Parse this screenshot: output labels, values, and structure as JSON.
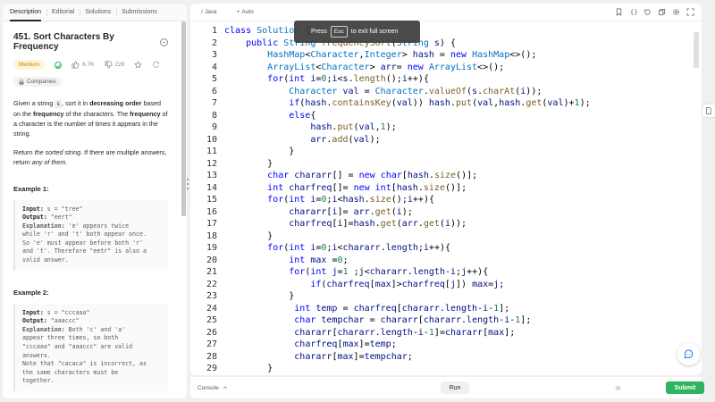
{
  "left_tabs": [
    "Description",
    "Editorial",
    "Solutions",
    "Submissions"
  ],
  "problem": {
    "title": "451. Sort Characters By Frequency",
    "difficulty": "Medium",
    "likes": "6.7K",
    "dislikes": "229",
    "companies_label": "Companies",
    "para1_parts": [
      "Given a string ",
      "s",
      ", sort it in ",
      "decreasing order",
      " based on the ",
      "frequency",
      " of the characters. The ",
      "frequency",
      " of a character is the number of times it appears in the string."
    ],
    "para2_parts": [
      "Return ",
      "the sorted string",
      ". If there are multiple answers, return ",
      "any of them",
      "."
    ]
  },
  "examples": [
    {
      "title": "Example 1:",
      "input_label": "Input:",
      "input": " s = \"tree\"",
      "output_label": "Output:",
      "output": " \"eert\"",
      "explanation_label": "Explanation:",
      "explanation": " 'e' appears twice\nwhile 'r' and 't' both appear once.\nSo 'e' must appear before both 'r'\nand 't'. Therefore \"eetr\" is also a\nvalid answer."
    },
    {
      "title": "Example 2:",
      "input_label": "Input:",
      "input": " s = \"cccaaa\"",
      "output_label": "Output:",
      "output": " \"aaaccc\"",
      "explanation_label": "Explanation:",
      "explanation": " Both 'c' and 'a'\nappear three times, so both\n\"cccaaa\" and \"aaaccc\" are valid\nanswers.\nNote that \"cacaca\" is incorrect, as\nthe same characters must be\ntogether."
    }
  ],
  "editor": {
    "language": "Java",
    "auto_label": "Auto",
    "toast_press": "Press",
    "toast_key": "Esc",
    "toast_rest": "to exit full screen",
    "console_label": "Console",
    "run_label": "Run",
    "submit_label": "Submit"
  },
  "code_lines": [
    {
      "n": "1",
      "t": "class Solution {"
    },
    {
      "n": "2",
      "t": "    public String frequencySort(String s) {"
    },
    {
      "n": "3",
      "t": "        HashMap<Character,Integer> hash = new HashMap<>();"
    },
    {
      "n": "4",
      "t": "        ArrayList<Character> arr= new ArrayList<>();"
    },
    {
      "n": "5",
      "t": "        for(int i=0;i<s.length();i++){"
    },
    {
      "n": "6",
      "t": "            Character val = Character.valueOf(s.charAt(i));"
    },
    {
      "n": "7",
      "t": "            if(hash.containsKey(val)) hash.put(val,hash.get(val)+1);"
    },
    {
      "n": "8",
      "t": "            else{"
    },
    {
      "n": "9",
      "t": "                hash.put(val,1);"
    },
    {
      "n": "10",
      "t": "                arr.add(val);"
    },
    {
      "n": "11",
      "t": "            }"
    },
    {
      "n": "12",
      "t": "        }"
    },
    {
      "n": "13",
      "t": "        char chararr[] = new char[hash.size()];"
    },
    {
      "n": "14",
      "t": "        int charfreq[]= new int[hash.size()];"
    },
    {
      "n": "15",
      "t": "        for(int i=0;i<hash.size();i++){"
    },
    {
      "n": "16",
      "t": "            chararr[i]= arr.get(i);"
    },
    {
      "n": "17",
      "t": "            charfreq[i]=hash.get(arr.get(i));"
    },
    {
      "n": "18",
      "t": "        }"
    },
    {
      "n": "19",
      "t": "        for(int i=0;i<chararr.length;i++){"
    },
    {
      "n": "20",
      "t": "            int max =0;"
    },
    {
      "n": "21",
      "t": "            for(int j=1 ;j<chararr.length-i;j++){"
    },
    {
      "n": "22",
      "t": "                if(charfreq[max]>charfreq[j]) max=j;"
    },
    {
      "n": "23",
      "t": "            }"
    },
    {
      "n": "24",
      "t": "             int temp = charfreq[chararr.length-i-1];"
    },
    {
      "n": "25",
      "t": "             char tempchar = chararr[chararr.length-i-1];"
    },
    {
      "n": "26",
      "t": "             chararr[chararr.length-i-1]=chararr[max];"
    },
    {
      "n": "27",
      "t": "             charfreq[max]=temp;"
    },
    {
      "n": "28",
      "t": "             chararr[max]=tempchar;"
    },
    {
      "n": "29",
      "t": "        }"
    }
  ],
  "colors": {
    "accent_green": "#2db55d",
    "medium_text": "#c68400",
    "keyword": "#0000ff"
  }
}
